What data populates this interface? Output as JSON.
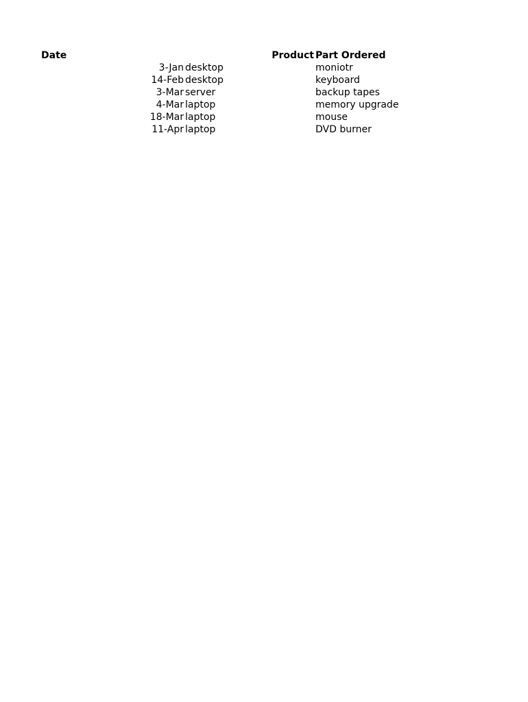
{
  "table": {
    "headers": {
      "date": "Date",
      "product": "Product",
      "part": "Part Ordered"
    },
    "rows": [
      {
        "date": "3-Jan",
        "product": "desktop",
        "part": "moniotr"
      },
      {
        "date": "14-Feb",
        "product": "desktop",
        "part": "keyboard"
      },
      {
        "date": "3-Mar",
        "product": "server",
        "part": "backup tapes"
      },
      {
        "date": "4-Mar",
        "product": "laptop",
        "part": "memory upgrade"
      },
      {
        "date": "18-Mar",
        "product": "laptop",
        "part": "mouse"
      },
      {
        "date": "11-Apr",
        "product": "laptop",
        "part": "DVD burner"
      }
    ]
  }
}
